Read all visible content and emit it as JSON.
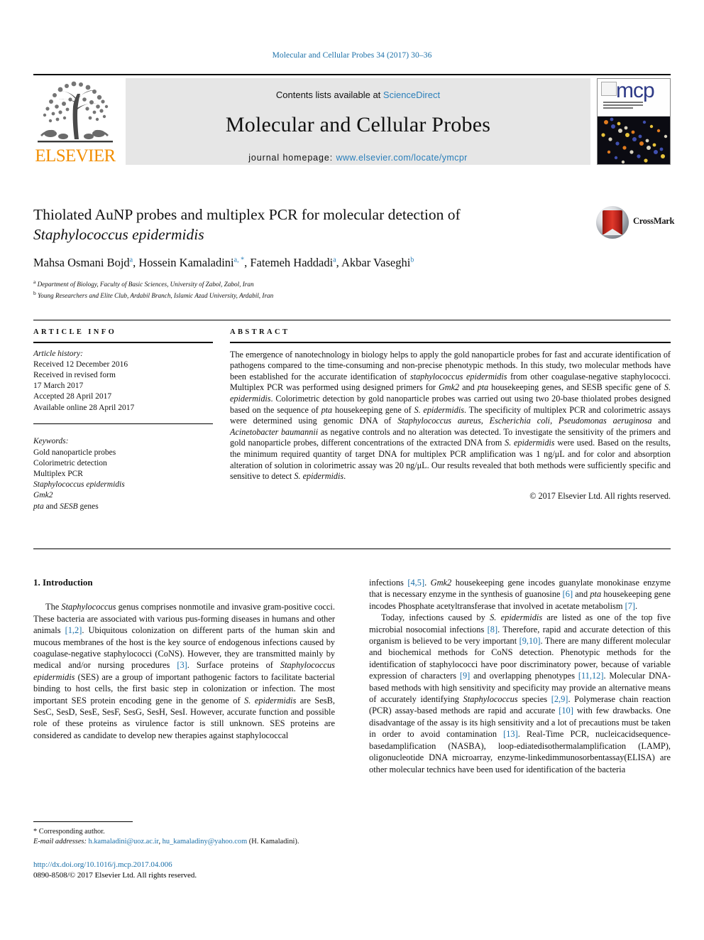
{
  "running_head": "Molecular and Cellular Probes 34 (2017) 30–36",
  "header": {
    "publisher": "ELSEVIER",
    "contents_prefix": "Contents lists available at ",
    "sciencedirect": "ScienceDirect",
    "journal_title": "Molecular and Cellular Probes",
    "homepage_label": "journal homepage: ",
    "homepage_url": "www.elsevier.com/locate/ymcpr",
    "cover_mark": "mcp"
  },
  "article": {
    "title_line1": "Thiolated AuNP probes and multiplex PCR for molecular detection of",
    "title_line2_italic": "Staphylococcus epidermidis",
    "crossmark_label": "CrossMark",
    "authors": [
      {
        "name": "Mahsa Osmani Bojd",
        "marks": "a"
      },
      {
        "name": "Hossein Kamaladini",
        "marks": "a, *"
      },
      {
        "name": "Fatemeh Haddadi",
        "marks": "a"
      },
      {
        "name": "Akbar Vaseghi",
        "marks": "b"
      }
    ],
    "affiliations": [
      {
        "mark": "a",
        "text": "Department of Biology, Faculty of Basic Sciences, University of Zabol, Zabol, Iran"
      },
      {
        "mark": "b",
        "text": "Young Researchers and Elite Club, Ardabil Branch, Islamic Azad University, Ardabil, Iran"
      }
    ]
  },
  "article_info": {
    "heading": "ARTICLE INFO",
    "history_label": "Article history:",
    "history": [
      "Received 12 December 2016",
      "Received in revised form",
      "17 March 2017",
      "Accepted 28 April 2017",
      "Available online 28 April 2017"
    ],
    "keywords_label": "Keywords:",
    "keywords": [
      "Gold nanoparticle probes",
      "Colorimetric detection",
      "Multiplex PCR",
      "Staphylococcus epidermidis",
      "Gmk2",
      "pta and SESB genes"
    ]
  },
  "abstract": {
    "heading": "ABSTRACT",
    "text": "The emergence of nanotechnology in biology helps to apply the gold nanoparticle probes for fast and accurate identification of pathogens compared to the time-consuming and non-precise phenotypic methods. In this study, two molecular methods have been established for the accurate identification of staphylococcus epidermidis from other coagulase-negative staphylococci. Multiplex PCR was performed using designed primers for Gmk2 and pta housekeeping genes, and SESB specific gene of S. epidermidis. Colorimetric detection by gold nanoparticle probes was carried out using two 20-base thiolated probes designed based on the sequence of pta housekeeping gene of S. epidermidis. The specificity of multiplex PCR and colorimetric assays were determined using genomic DNA of Staphylococcus aureus, Escherichia coli, Pseudomonas aeruginosa and Acinetobacter baumannii as negative controls and no alteration was detected. To investigate the sensitivity of the primers and gold nanoparticle probes, different concentrations of the extracted DNA from S. epidermidis were used. Based on the results, the minimum required quantity of target DNA for multiplex PCR amplification was 1 ng/μL and for color and absorption alteration of solution in colorimetric assay was 20 ng/μL. Our results revealed that both methods were sufficiently specific and sensitive to detect S. epidermidis.",
    "copyright": "© 2017 Elsevier Ltd. All rights reserved."
  },
  "body": {
    "section_heading": "1. Introduction",
    "left_paragraph_1": "The Staphylococcus genus comprises nonmotile and invasive gram-positive cocci. These bacteria are associated with various pus-forming diseases in humans and other animals [1,2]. Ubiquitous colonization on different parts of the human skin and mucous membranes of the host is the key source of endogenous infections caused by coagulase-negative staphylococci (CoNS). However, they are transmitted mainly by medical and/or nursing procedures [3]. Surface proteins of Staphylococcus epidermidis (SES) are a group of important pathogenic factors to facilitate bacterial binding to host cells, the first basic step in colonization or infection. The most important SES protein encoding gene in the genome of S. epidermidis are SesB, SesC, SesD, SesE, SesF, SesG, SesH, SesI. However, accurate function and possible role of these proteins as virulence factor is still unknown. SES proteins are considered as candidate to develop new therapies against staphylococcal",
    "right_paragraph_1": "infections [4,5]. Gmk2 housekeeping gene incodes guanylate monokinase enzyme that is necessary enzyme in the synthesis of guanosine [6] and pta housekeeping gene incodes Phosphate acetyltransferase that involved in acetate metabolism [7].",
    "right_paragraph_2": "Today, infections caused by S. epidermidis are listed as one of the top five microbial nosocomial infections [8]. Therefore, rapid and accurate detection of this organism is believed to be very important [9,10]. There are many different molecular and biochemical methods for CoNS detection. Phenotypic methods for the identification of staphylococci have poor discriminatory power, because of variable expression of characters [9] and overlapping phenotypes [11,12]. Molecular DNA-based methods with high sensitivity and specificity may provide an alternative means of accurately identifying Staphylococcus species [2,9]. Polymerase chain reaction (PCR) assay-based methods are rapid and accurate [10] with few drawbacks. One disadvantage of the assay is its high sensitivity and a lot of precautions must be taken in order to avoid contamination [13]. Real-Time PCR, nucleicacidsequence-basedamplification (NASBA), loop-ediatedisothermalamplification (LAMP), oligonucleotide DNA microarray, enzyme-linkedimmunosorbentassay(ELISA) are other molecular technics have been used for identification of the bacteria"
  },
  "footnotes": {
    "corresponding": "* Corresponding author.",
    "email_label": "E-mail addresses:",
    "email_1": "h.kamaladini@uoz.ac.ir",
    "email_2": "hu_kamaladiny@yahoo.com",
    "email_owner": "(H. Kamaladini).",
    "doi": "http://dx.doi.org/10.1016/j.mcp.2017.04.006",
    "issn_line": "0890-8508/© 2017 Elsevier Ltd. All rights reserved."
  },
  "colors": {
    "link_blue": "#1a6fa8",
    "elsevier_orange": "#F28E00",
    "band_gray": "#e6e6e6",
    "crossmark_red": "#c4241a"
  }
}
